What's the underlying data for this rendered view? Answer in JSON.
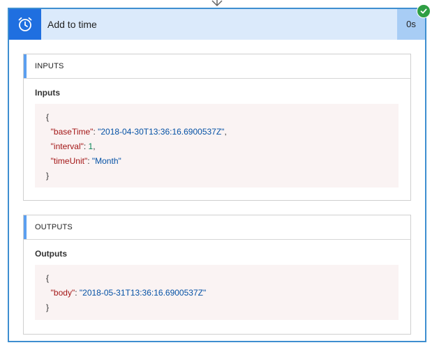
{
  "action": {
    "title": "Add to time",
    "duration": "0s",
    "icon": "alarm-clock-icon",
    "status_icon": "check-icon",
    "accent_color": "#1f6fe0",
    "status_color": "#2f9e44"
  },
  "inputs_section": {
    "header": "INPUTS",
    "label": "Inputs",
    "open_brace": "{",
    "close_brace": "}",
    "fields": [
      {
        "key": "\"baseTime\"",
        "value": "\"2018-04-30T13:36:16.6900537Z\"",
        "trail": ","
      },
      {
        "key": "\"interval\"",
        "value": "1",
        "trail": ","
      },
      {
        "key": "\"timeUnit\"",
        "value": "\"Month\"",
        "trail": ""
      }
    ]
  },
  "outputs_section": {
    "header": "OUTPUTS",
    "label": "Outputs",
    "open_brace": "{",
    "close_brace": "}",
    "fields": [
      {
        "key": "\"body\"",
        "value": "\"2018-05-31T13:36:16.6900537Z\"",
        "trail": ""
      }
    ]
  }
}
